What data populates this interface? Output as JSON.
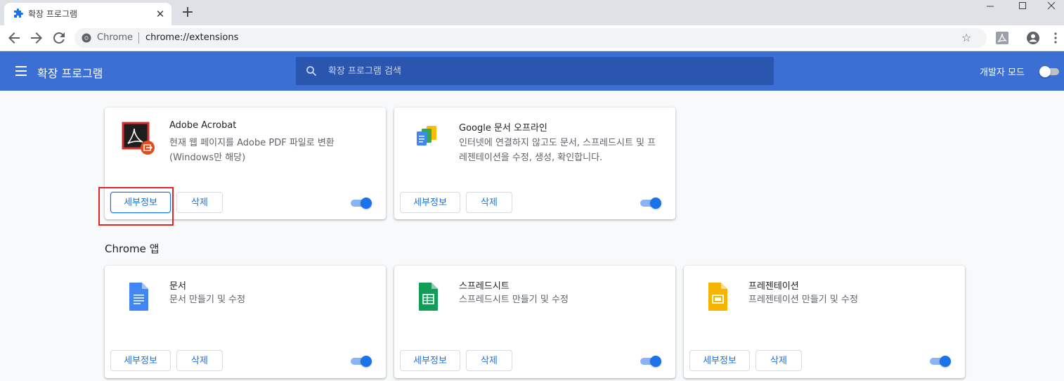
{
  "browser": {
    "tab_title": "확장 프로그램",
    "omnibox_site": "Chrome",
    "omnibox_url": "chrome://extensions"
  },
  "header": {
    "title": "확장 프로그램",
    "search_placeholder": "확장 프로그램 검색",
    "dev_mode_label": "개발자 모드",
    "dev_mode_enabled": false
  },
  "extensions": [
    {
      "name": "Adobe Acrobat",
      "description": "현재 웹 페이지를 Adobe PDF 파일로 변환 (Windows만 해당)",
      "icon": "adobe-acrobat-icon",
      "enabled": true
    },
    {
      "name": "Google 문서 오프라인",
      "description": "인터넷에 연결하지 않고도 문서, 스프레드시트 및 프레젠테이션을 수정, 생성, 확인합니다.",
      "icon": "google-docs-offline-icon",
      "enabled": true
    }
  ],
  "apps_section_title": "Chrome 앱",
  "apps": [
    {
      "name": "문서",
      "description": "문서 만들기 및 수정",
      "icon": "google-docs-icon",
      "enabled": true
    },
    {
      "name": "스프레드시트",
      "description": "스프레드시트 만들기 및 수정",
      "icon": "google-sheets-icon",
      "enabled": true
    },
    {
      "name": "프레젠테이션",
      "description": "프레젠테이션 만들기 및 수정",
      "icon": "google-slides-icon",
      "enabled": true
    }
  ],
  "buttons": {
    "details": "세부정보",
    "remove": "삭제"
  },
  "colors": {
    "header_blue": "#3b6fd4",
    "accent_blue": "#1a73e8",
    "highlight_red": "#e32424"
  }
}
